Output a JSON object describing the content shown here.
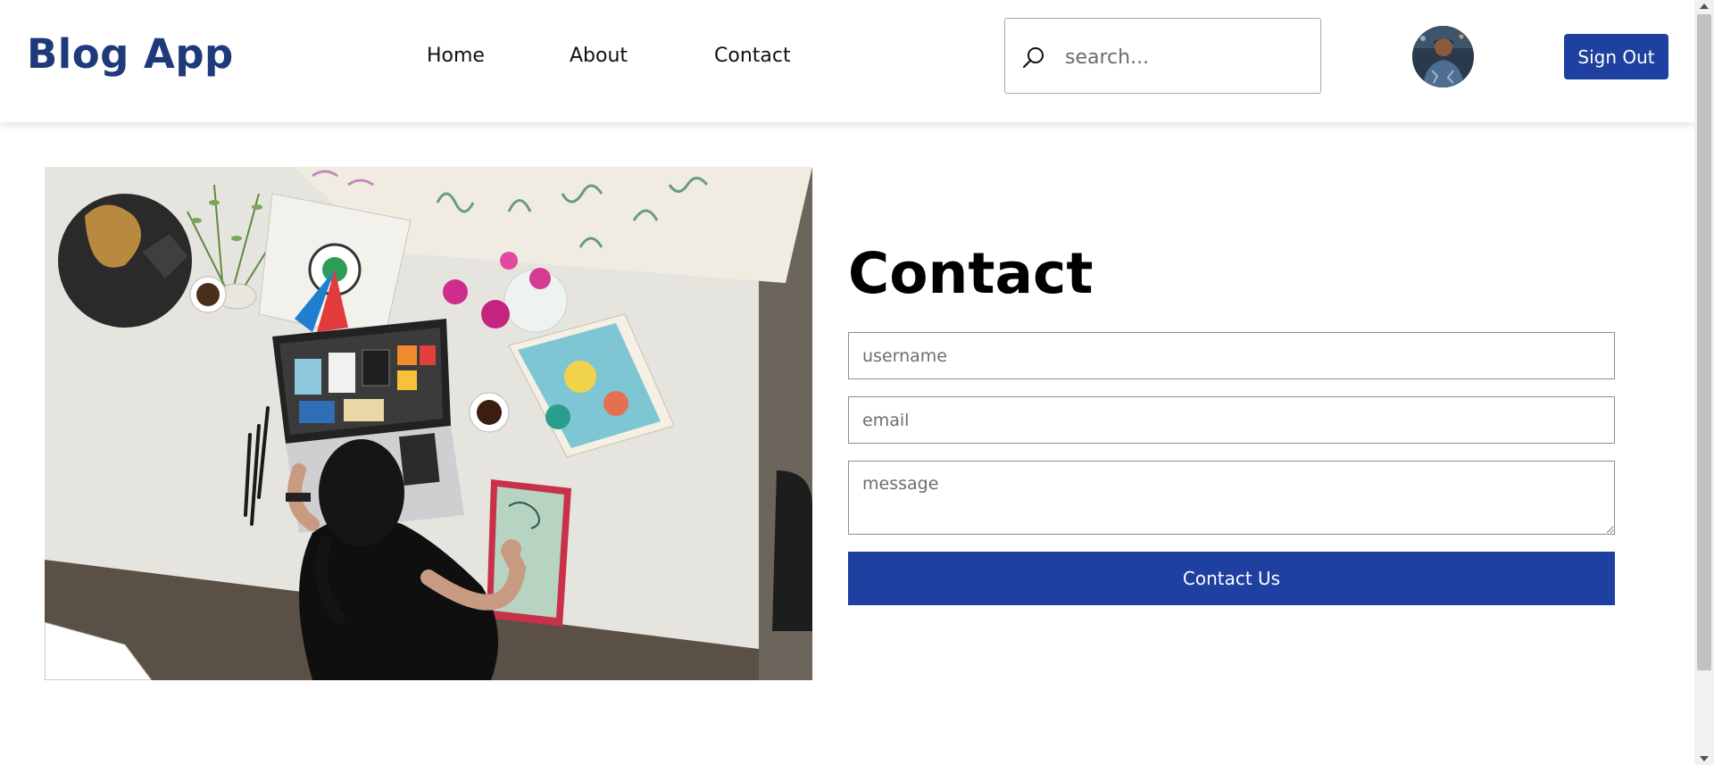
{
  "navbar": {
    "brand": "Blog App",
    "links": [
      "Home",
      "About",
      "Contact"
    ],
    "search_placeholder": "search...",
    "sign_out_label": "Sign Out"
  },
  "contact": {
    "title": "Contact",
    "username_placeholder": "username",
    "email_placeholder": "email",
    "message_placeholder": "message",
    "submit_label": "Contact Us"
  },
  "colors": {
    "brand": "#1e3a7a",
    "primary_button": "#1e40a0"
  }
}
